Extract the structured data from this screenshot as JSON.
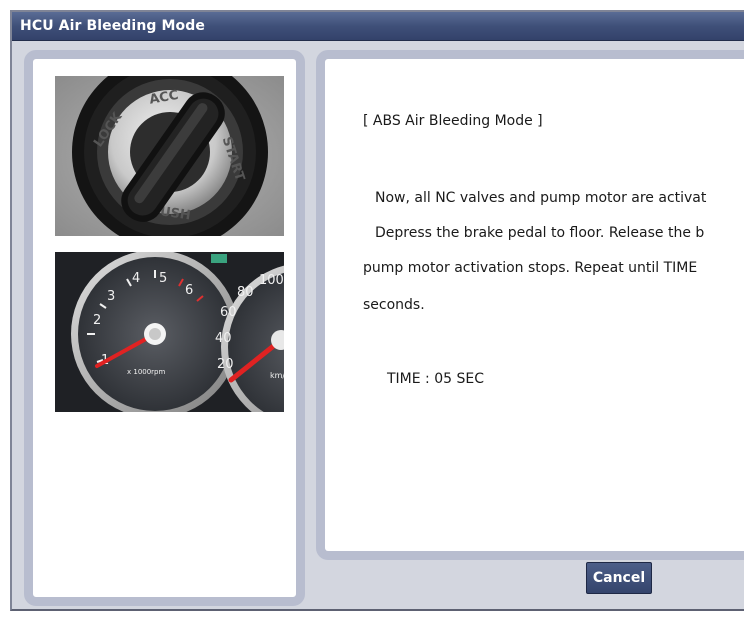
{
  "window": {
    "title": "HCU Air Bleeding Mode"
  },
  "left_panel": {
    "images": [
      {
        "icon": "ignition-key-image",
        "labels": [
          "LOCK",
          "ACC",
          "START",
          "PUSH"
        ]
      },
      {
        "icon": "instrument-cluster-image",
        "tach_numbers": [
          "1",
          "2",
          "3",
          "4",
          "5",
          "6"
        ],
        "tach_unit": "x 1000rpm",
        "speedo_numbers": [
          "20",
          "40",
          "60",
          "80",
          "100"
        ],
        "speedo_unit": "km/h"
      }
    ]
  },
  "content": {
    "heading": "[ ABS Air Bleeding Mode ]",
    "line1": "Now, all NC valves and pump motor are activat",
    "line2": "Depress the brake pedal to floor. Release the b",
    "line3": "pump motor activation stops. Repeat until TIME",
    "line4": "seconds.",
    "time_display": "TIME : 05 SEC"
  },
  "buttons": {
    "cancel_label": "Cancel"
  },
  "colors": {
    "titlebar": "#3f5079",
    "panel_border": "#b8bdcf",
    "window_bg": "#d3d6df",
    "button": "#3f4f78"
  }
}
